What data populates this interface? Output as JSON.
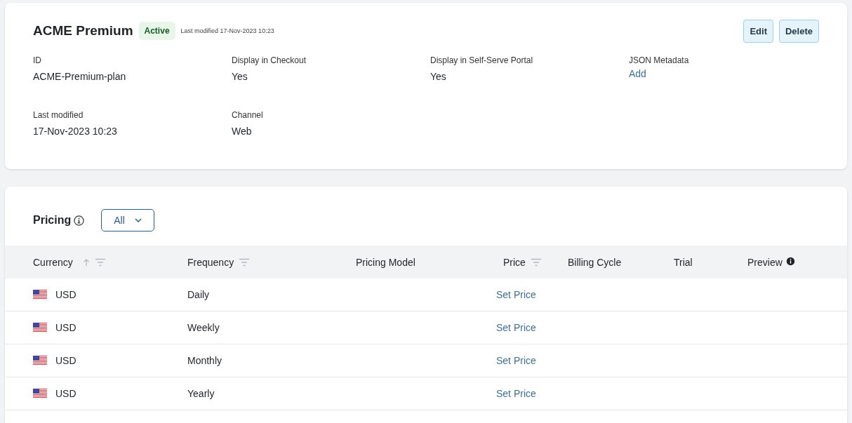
{
  "plan": {
    "title": "ACME Premium",
    "status": "Active",
    "modified_note": "Last modified 17-Nov-2023 10:23",
    "actions": [
      "Edit",
      "Delete"
    ],
    "fields": [
      {
        "label": "ID",
        "value": "ACME-Premium-plan",
        "kind": "text"
      },
      {
        "label": "Display in Checkout",
        "value": "Yes",
        "kind": "text"
      },
      {
        "label": "Display in Self-Serve Portal",
        "value": "Yes",
        "kind": "text"
      },
      {
        "label": "JSON Metadata",
        "value": "Add",
        "kind": "link"
      },
      {
        "label": "Last modified",
        "value": "17-Nov-2023 10:23",
        "kind": "text"
      },
      {
        "label": "Channel",
        "value": "Web",
        "kind": "text"
      }
    ]
  },
  "pricing": {
    "title": "Pricing",
    "filter": "All",
    "columns": [
      {
        "label": "Currency",
        "sort": true,
        "filter": true,
        "info": false
      },
      {
        "label": "Frequency",
        "sort": false,
        "filter": true,
        "info": false
      },
      {
        "label": "Pricing Model",
        "sort": false,
        "filter": false,
        "info": false
      },
      {
        "label": "Price",
        "sort": false,
        "filter": true,
        "info": false
      },
      {
        "label": "Billing Cycle",
        "sort": false,
        "filter": false,
        "info": false
      },
      {
        "label": "Trial",
        "sort": false,
        "filter": false,
        "info": false
      },
      {
        "label": "Preview",
        "sort": false,
        "filter": false,
        "info": true
      }
    ],
    "rows": [
      {
        "currency": "USD",
        "frequency": "Daily",
        "price": "Set Price"
      },
      {
        "currency": "USD",
        "frequency": "Weekly",
        "price": "Set Price"
      },
      {
        "currency": "USD",
        "frequency": "Monthly",
        "price": "Set Price"
      },
      {
        "currency": "USD",
        "frequency": "Yearly",
        "price": "Set Price"
      }
    ]
  }
}
